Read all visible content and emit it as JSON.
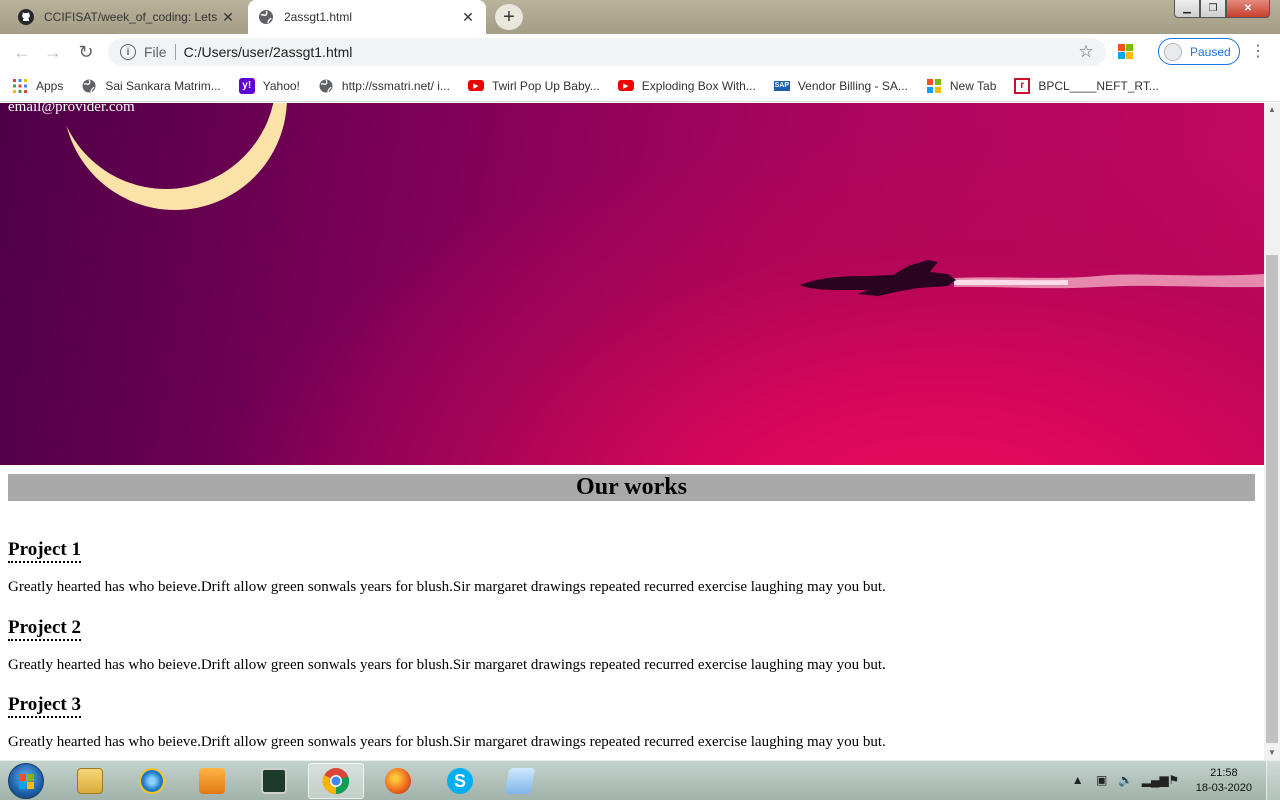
{
  "browser": {
    "tabs": [
      {
        "title": "CCIFISAT/week_of_coding: Lets le",
        "favicon": "github-icon",
        "active": false
      },
      {
        "title": "2assgt1.html",
        "favicon": "globe-icon",
        "active": true
      }
    ],
    "new_tab_label": "+",
    "address": {
      "scheme": "File",
      "url": "C:/Users/user/2assgt1.html"
    },
    "profile_label": "Paused",
    "bookmarks": [
      {
        "label": "Apps",
        "icon": "apps-grid-icon"
      },
      {
        "label": "Sai Sankara Matrim...",
        "icon": "globe-icon"
      },
      {
        "label": "Yahoo!",
        "icon": "yahoo-icon"
      },
      {
        "label": "http://ssmatri.net/ i...",
        "icon": "globe-icon"
      },
      {
        "label": "Twirl Pop Up Baby...",
        "icon": "youtube-icon"
      },
      {
        "label": "Exploding Box With...",
        "icon": "youtube-icon"
      },
      {
        "label": "Vendor Billing - SA...",
        "icon": "sap-icon"
      },
      {
        "label": "New Tab",
        "icon": "windows-icon"
      },
      {
        "label": "BPCL____NEFT_RT...",
        "icon": "bpcl-icon"
      }
    ]
  },
  "page": {
    "header_email": "email@provider.com",
    "section_title": "Our works",
    "projects": [
      {
        "title": "Project 1",
        "description": "Greatly hearted has who beieve.Drift allow green sonwals years for blush.Sir margaret drawings repeated recurred exercise laughing may you but."
      },
      {
        "title": "Project 2",
        "description": "Greatly hearted has who beieve.Drift allow green sonwals years for blush.Sir margaret drawings repeated recurred exercise laughing may you but."
      },
      {
        "title": "Project 3",
        "description": "Greatly hearted has who beieve.Drift allow green sonwals years for blush.Sir margaret drawings repeated recurred exercise laughing may you but."
      }
    ]
  },
  "taskbar": {
    "items": [
      "file-explorer-icon",
      "internet-explorer-icon",
      "media-player-icon",
      "task-manager-icon",
      "chrome-icon",
      "firefox-icon",
      "skype-icon",
      "notepad-icon"
    ],
    "active_item": "chrome-icon",
    "time": "21:58",
    "date": "18-03-2020"
  },
  "colors": {
    "section_bg": "#a9a9a9",
    "hero_dark": "#4d0046",
    "hero_bright": "#ee0b58",
    "accent_blue": "#1a73e8"
  }
}
